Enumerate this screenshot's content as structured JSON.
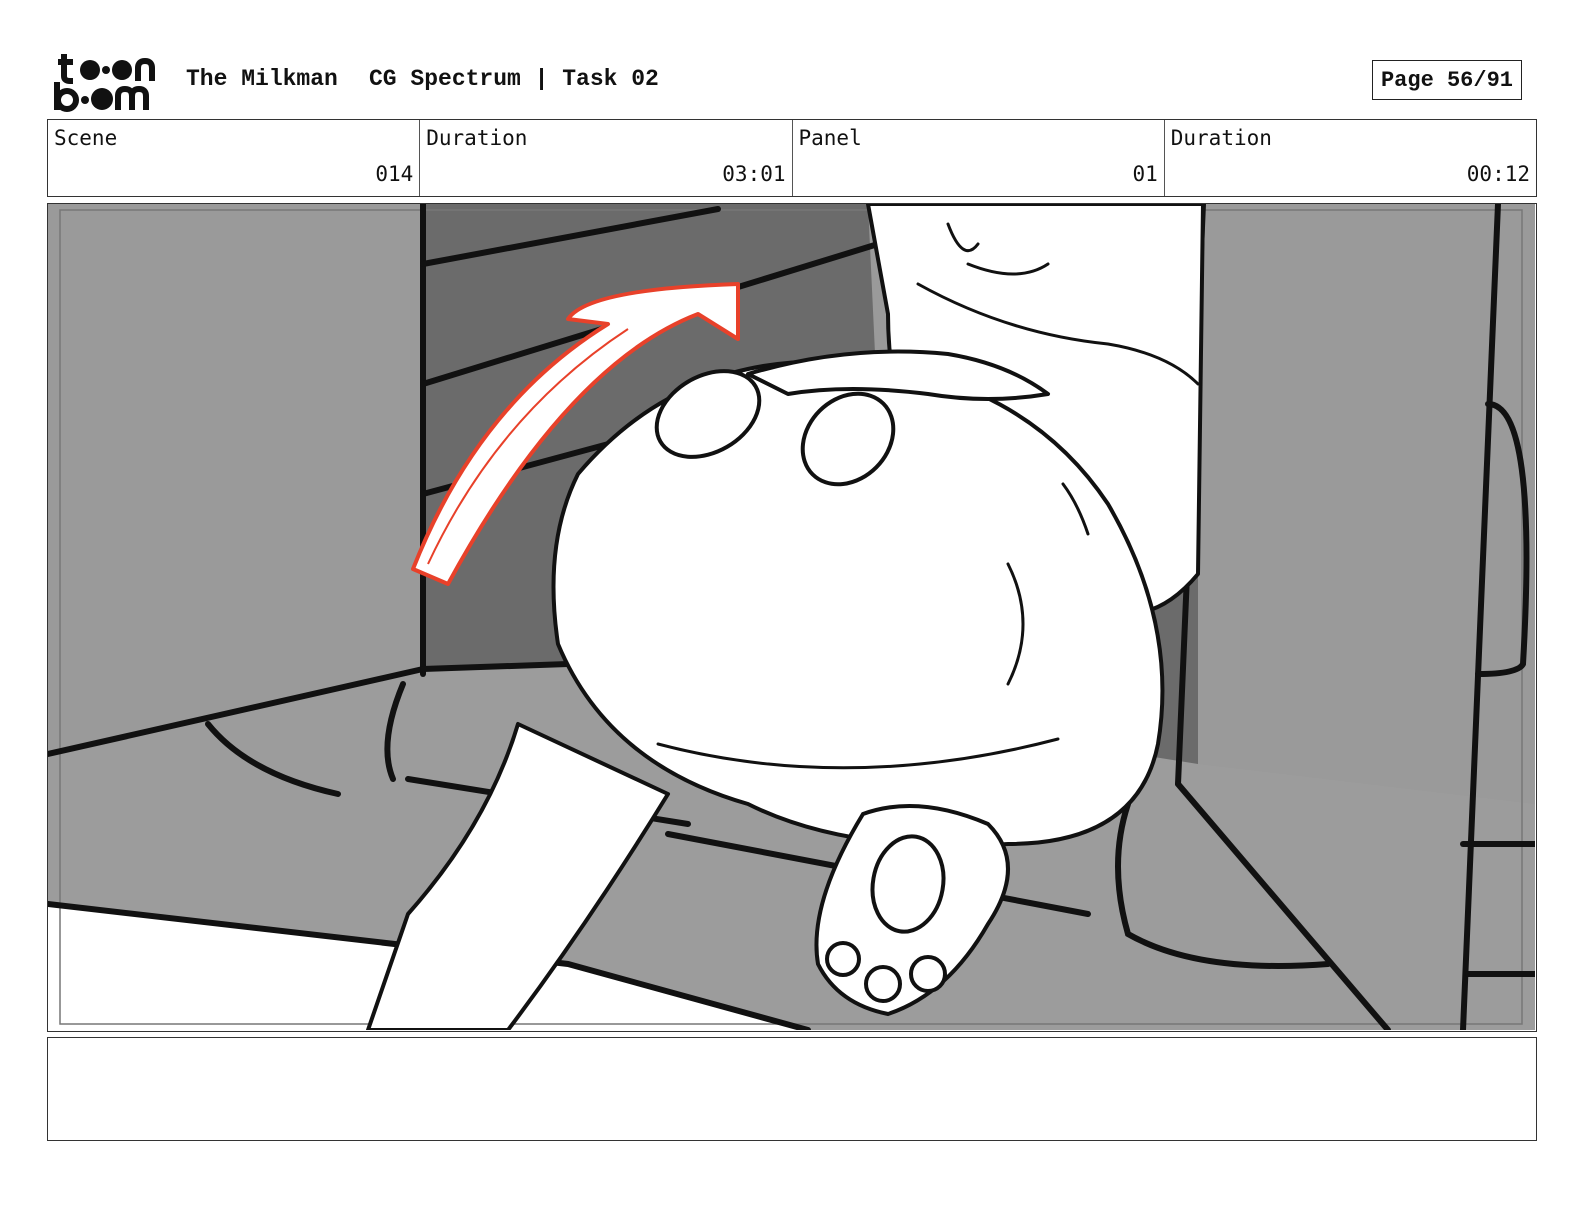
{
  "header": {
    "logo_text_top": "toon",
    "logo_text_bottom": "boom",
    "project_title": "The Milkman",
    "subtitle": "CG Spectrum | Task 02",
    "page_label": "Page 56/91"
  },
  "info": {
    "scene_label": "Scene",
    "scene_value": "014",
    "scene_duration_label": "Duration",
    "scene_duration_value": "03:01",
    "panel_label": "Panel",
    "panel_value": "01",
    "panel_duration_label": "Duration",
    "panel_duration_value": "00:12"
  },
  "notes": {
    "text": ""
  },
  "colors": {
    "arrow": "#e8412a",
    "wall_mid": "#9a9a9a",
    "wall_dark": "#6a6a6a",
    "line": "#111111"
  }
}
